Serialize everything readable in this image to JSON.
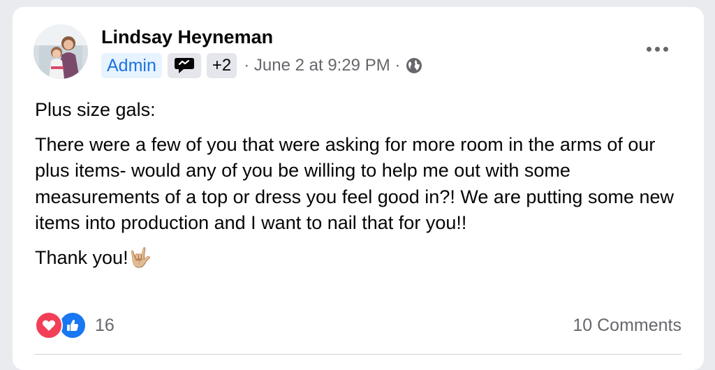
{
  "post": {
    "author": "Lindsay Heyneman",
    "badges": {
      "admin": "Admin",
      "more": "+2"
    },
    "timestamp": "· June 2 at 9:29 PM ·",
    "privacy_icon": "globe-icon",
    "paragraphs": [
      "Plus size gals:",
      "There were a few of you that were asking for more room in the arms of our plus items- would any of you be willing to help me out with some measurements of a top or dress you feel good in?! We are putting some new items into production and I want to nail that for you!!",
      "Thank you!🤟🏼"
    ],
    "reactions": {
      "types": [
        "love-icon",
        "like-icon"
      ],
      "count": "16"
    },
    "comments_label": "10 Comments"
  },
  "colors": {
    "admin_badge_bg": "#e7f3ff",
    "admin_badge_text": "#1b74e4",
    "love": "#f33e58",
    "like": "#1877f2",
    "secondary_text": "#65676b"
  }
}
